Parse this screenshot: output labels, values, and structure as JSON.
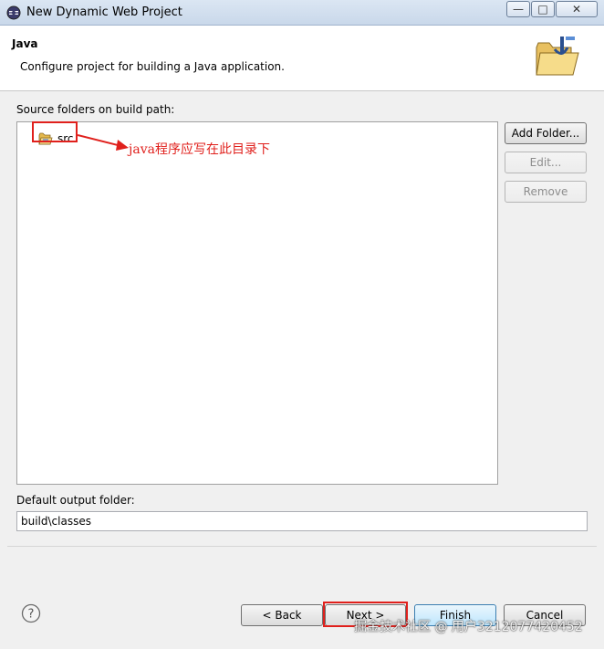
{
  "window": {
    "title": "New Dynamic Web Project"
  },
  "header": {
    "title": "Java",
    "description": "Configure project for building a Java application."
  },
  "source": {
    "label": "Source folders on build path:",
    "items": [
      {
        "label": "src"
      }
    ]
  },
  "annotation": {
    "text": "java程序应写在此目录下",
    "color": "#e0201c"
  },
  "side_buttons": {
    "add_folder": "Add Folder...",
    "edit": "Edit...",
    "remove": "Remove"
  },
  "output": {
    "label": "Default output folder:",
    "value": "build\\classes"
  },
  "footer": {
    "back": "< Back",
    "next": "Next >",
    "finish": "Finish",
    "cancel": "Cancel"
  },
  "watermark": "掘金技术社区 @ 用户3212077420452",
  "icons": [
    "eclipse-app-icon",
    "minimize-icon",
    "maximize-icon",
    "close-icon",
    "folder-java-icon",
    "source-folder-icon",
    "arrow-icon",
    "help-icon"
  ]
}
